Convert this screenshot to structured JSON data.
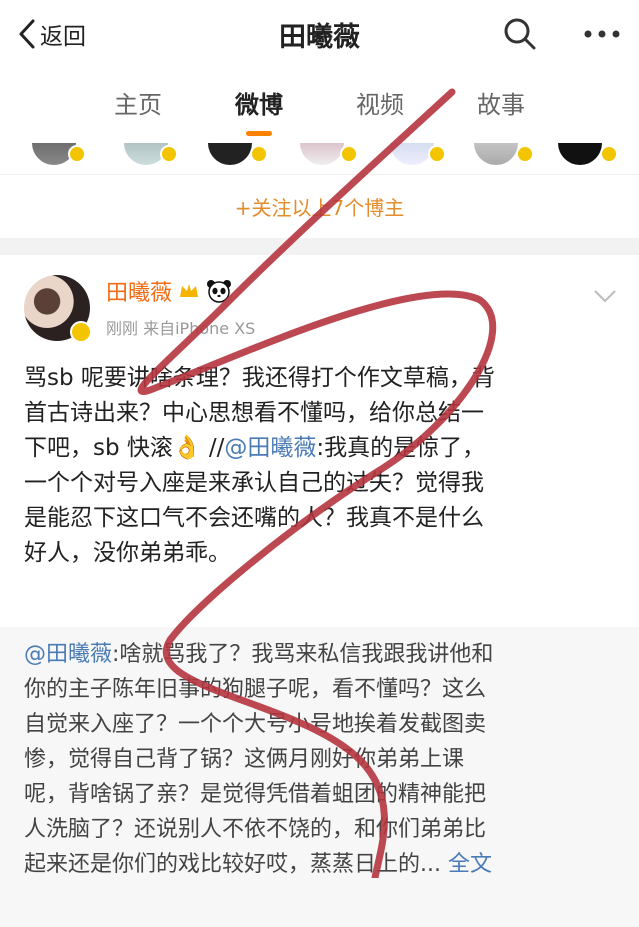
{
  "header": {
    "back_label": "返回",
    "title": "田曦薇"
  },
  "tabs": [
    {
      "label": "主页",
      "active": false
    },
    {
      "label": "微博",
      "active": true
    },
    {
      "label": "视频",
      "active": false
    },
    {
      "label": "故事",
      "active": false
    }
  ],
  "follow_more": "+关注以上7个博主",
  "post": {
    "username": "田曦薇",
    "time": "刚刚",
    "source": "来自iPhone XS",
    "text_lines": [
      "骂sb 呢要讲啥条理？我还得打个作文草稿，背",
      "首古诗出来？中心思想看不懂吗，给你总结一",
      "下吧，sb 快滚👌 //",
      "一个个对号入座是来承认自己的过失？觉得我",
      "是能忍下这口气不会还嘴的人？我真不是什么",
      "好人，没你弟弟乖。"
    ],
    "mention": "@田曦薇",
    "line3_tail": ":我真的是惊了，"
  },
  "repost": {
    "mention": "@田曦薇",
    "lines": [
      ":啥就骂我了？我骂来私信我跟我讲他和",
      "你的主子陈年旧事的狗腿子呢，看不懂吗？这么",
      "自觉来入座了？一个个大号小号地挨着发截图卖",
      "惨，觉得自己背了锅？这俩月刚好你弟弟上课",
      "呢，背啥锅了亲？是觉得凭借着蛆团的精神能把",
      "人洗脑了？还说别人不依不饶的，和你们弟弟比",
      "起来还是你们的戏比较好哎，蒸蒸日上的..."
    ],
    "full_text_label": "全文"
  },
  "colors": {
    "accent": "#ff8200",
    "username": "#f06b13",
    "link": "#4a7bb5",
    "scribble": "#b5343f"
  }
}
